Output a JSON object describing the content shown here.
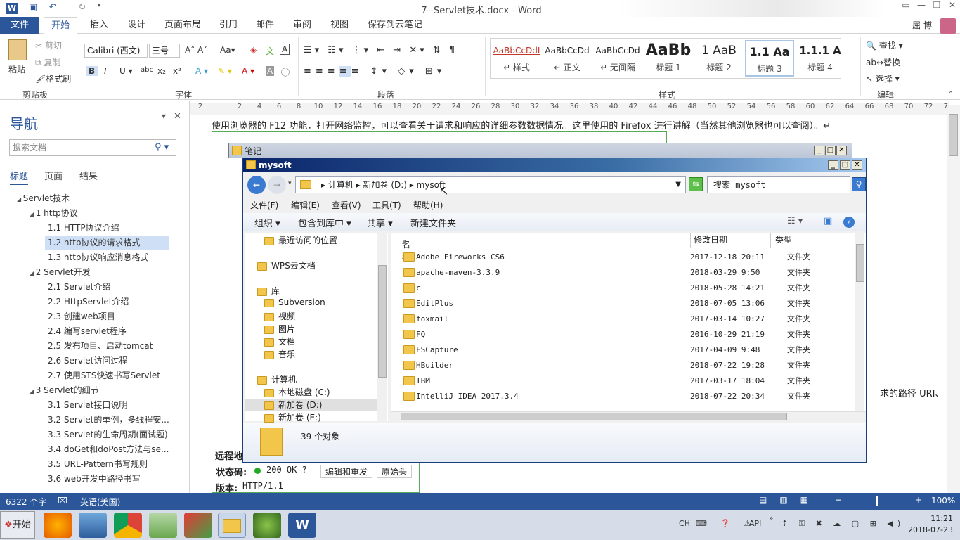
{
  "word": {
    "title": "7--Servlet技术.docx - Word",
    "user": "屈 博",
    "tabs": [
      "文件",
      "开始",
      "插入",
      "设计",
      "页面布局",
      "引用",
      "邮件",
      "审阅",
      "视图",
      "保存到云笔记"
    ],
    "ribbon": {
      "clipboard": {
        "paste": "粘贴",
        "cut": "剪切",
        "copy": "复制",
        "format_painter": "格式刷",
        "label": "剪贴板"
      },
      "font": {
        "name": "Calibri (西文)",
        "size": "三号",
        "label": "字体"
      },
      "paragraph": {
        "label": "段落"
      },
      "styles": {
        "label": "样式",
        "items": [
          {
            "preview": "AaBbCcDdI",
            "name": "↵ 样式"
          },
          {
            "preview": "AaBbCcDd",
            "name": "↵ 正文"
          },
          {
            "preview": "AaBbCcDd",
            "name": "↵ 无间隔"
          },
          {
            "preview": "AaBb",
            "name": "标题 1"
          },
          {
            "preview": "1  AaB",
            "name": "标题 2"
          },
          {
            "preview": "1.1  Aa",
            "name": "标题 3"
          },
          {
            "preview": "1.1.1 A",
            "name": "标题 4"
          }
        ]
      },
      "editing": {
        "find": "查找",
        "replace": "替换",
        "select": "选择",
        "label": "编辑"
      }
    },
    "nav": {
      "title": "导航",
      "search_placeholder": "搜索文档",
      "tabs": [
        "标题",
        "页面",
        "结果"
      ],
      "tree": [
        {
          "text": "Servlet技术",
          "level": 0
        },
        {
          "text": "1 http协议",
          "level": 1
        },
        {
          "text": "1.1 HTTP协议介绍",
          "level": 2
        },
        {
          "text": "1.2 http协议的请求格式",
          "level": 2,
          "selected": true
        },
        {
          "text": "1.3 http协议响应消息格式",
          "level": 2
        },
        {
          "text": "2 Servlet开发",
          "level": 1
        },
        {
          "text": "2.1 Servlet介绍",
          "level": 2
        },
        {
          "text": "2.2 HttpServlet介绍",
          "level": 2
        },
        {
          "text": "2.3 创建web项目",
          "level": 2
        },
        {
          "text": "2.4 编写servlet程序",
          "level": 2
        },
        {
          "text": "2.5 发布项目、启动tomcat",
          "level": 2
        },
        {
          "text": "2.6 Servlet访问过程",
          "level": 2
        },
        {
          "text": "2.7 使用STS快速书写Servlet",
          "level": 2
        },
        {
          "text": "3 Servlet的细节",
          "level": 1
        },
        {
          "text": "3.1 Servlet接口说明",
          "level": 2
        },
        {
          "text": "3.2 Servlet的单例，多线程安...",
          "level": 2
        },
        {
          "text": "3.3 Servlet的生命周期(面试题)",
          "level": 2
        },
        {
          "text": "3.4 doGet和doPost方法与se...",
          "level": 2
        },
        {
          "text": "3.5 URL-Pattern书写规则",
          "level": 2
        },
        {
          "text": "3.6 web开发中路径书写",
          "level": 2
        }
      ]
    },
    "ruler": [
      "2",
      "",
      "2",
      "4",
      "6",
      "8",
      "10",
      "12",
      "14",
      "16",
      "18",
      "20",
      "22",
      "24",
      "26",
      "28",
      "30",
      "32",
      "34",
      "36",
      "38",
      "40",
      "42",
      "44",
      "46",
      "48",
      "50",
      "52",
      "54",
      "56",
      "58",
      "60",
      "62",
      "64",
      "66",
      "68",
      "70",
      "72",
      "74"
    ],
    "doc": {
      "line1": "使用浏览器的 F12 功能，打开网络监控，可以查看关于请求和响应的详细参数数据情况。这里使用的 Firefox 进行讲解（当然其他浏览器也可以查阅）。↵",
      "right_frag": "求的路径 URI、",
      "status_code_label": "状态码:",
      "status_code": "200 OK",
      "edit_resend": "编辑和重发",
      "raw_headers": "原始头",
      "version_label": "版本:",
      "version": "HTTP/1.1",
      "remote": "远程地"
    },
    "status": {
      "words": "6322 个字",
      "lang": "英语(美国)",
      "zoom": "100%"
    }
  },
  "note_window": {
    "title": "笔记"
  },
  "explorer": {
    "title": "mysoft",
    "breadcrumb": [
      "计算机",
      "新加卷 (D:)",
      "mysoft"
    ],
    "search_placeholder": "搜索 mysoft",
    "menu": [
      "文件(F)",
      "编辑(E)",
      "查看(V)",
      "工具(T)",
      "帮助(H)"
    ],
    "commands": [
      "组织",
      "包含到库中",
      "共享",
      "新建文件夹"
    ],
    "nav_items": [
      {
        "text": "最近访问的位置",
        "indent": 1
      },
      {
        "text": "WPS云文档",
        "indent": 0
      },
      {
        "text": "库",
        "indent": 0
      },
      {
        "text": "Subversion",
        "indent": 1
      },
      {
        "text": "视频",
        "indent": 1
      },
      {
        "text": "图片",
        "indent": 1
      },
      {
        "text": "文档",
        "indent": 1
      },
      {
        "text": "音乐",
        "indent": 1
      },
      {
        "text": "计算机",
        "indent": 0
      },
      {
        "text": "本地磁盘 (C:)",
        "indent": 1
      },
      {
        "text": "新加卷 (D:)",
        "indent": 1,
        "selected": true
      },
      {
        "text": "新加卷 (E:)",
        "indent": 1
      }
    ],
    "columns": [
      "名称",
      "修改日期",
      "类型"
    ],
    "files": [
      {
        "name": "Adobe Fireworks CS6",
        "date": "2017-12-18 20:11",
        "type": "文件夹"
      },
      {
        "name": "apache-maven-3.3.9",
        "date": "2018-03-29 9:50",
        "type": "文件夹"
      },
      {
        "name": "c",
        "date": "2018-05-28 14:21",
        "type": "文件夹"
      },
      {
        "name": "EditPlus",
        "date": "2018-07-05 13:06",
        "type": "文件夹"
      },
      {
        "name": "foxmail",
        "date": "2017-03-14 10:27",
        "type": "文件夹"
      },
      {
        "name": "FQ",
        "date": "2016-10-29 21:19",
        "type": "文件夹"
      },
      {
        "name": "FSCapture",
        "date": "2017-04-09 9:48",
        "type": "文件夹"
      },
      {
        "name": "HBuilder",
        "date": "2018-07-22 19:28",
        "type": "文件夹"
      },
      {
        "name": "IBM",
        "date": "2017-03-17 18:04",
        "type": "文件夹"
      },
      {
        "name": "IntelliJ IDEA 2017.3.4",
        "date": "2018-07-22 20:34",
        "type": "文件夹"
      }
    ],
    "count": "39 个对象"
  },
  "taskbar": {
    "start": "开始",
    "lang": "CH",
    "api": "API",
    "time": "11:21",
    "date": "2018-07-23"
  }
}
